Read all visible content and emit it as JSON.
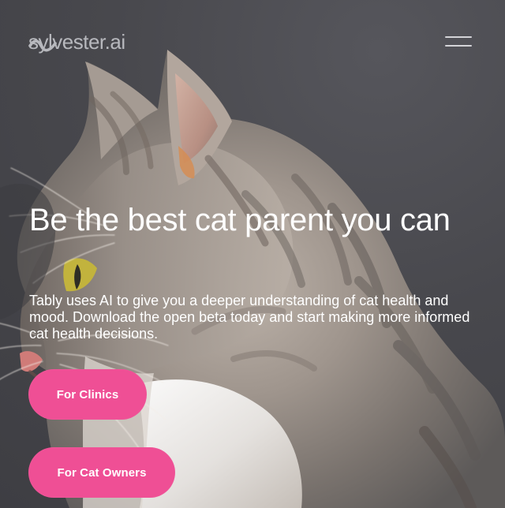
{
  "header": {
    "logo_text": "sylvester.ai",
    "logo_icon": "wave-icon",
    "menu_icon": "hamburger-icon"
  },
  "hero": {
    "headline": "Be the best cat parent you can",
    "description": "Tably uses AI to give you a deeper understanding of cat health and mood. Download the open beta today and start making more informed cat health decisions."
  },
  "actions": {
    "clinics_label": "For Clinics",
    "owners_label": "For Cat Owners"
  },
  "colors": {
    "background": "#46464b",
    "text": "#ffffff",
    "cta": "#ef4f95",
    "logo": "#b7b8bd"
  }
}
